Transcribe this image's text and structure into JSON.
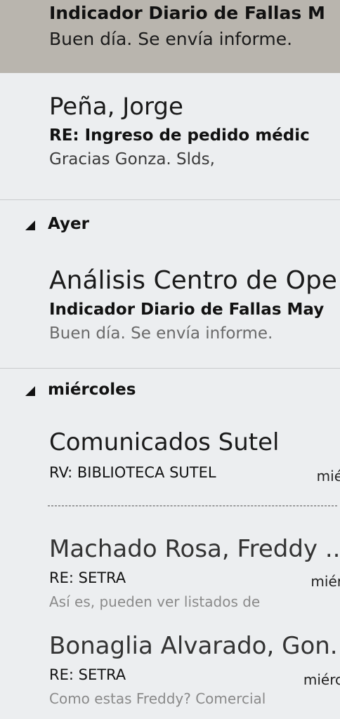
{
  "messages": [
    {
      "subject": "Indicador Diario de Fallas M",
      "preview": "Buen día.  Se envía informe."
    },
    {
      "sender": "Peña, Jorge",
      "subject": "RE: Ingreso de pedido médic",
      "preview": "Gracias Gonza.  Slds,"
    },
    {
      "sender": "Análisis Centro de Ope",
      "subject": "Indicador Diario de Fallas May",
      "preview": "Buen día.  Se envía informe."
    },
    {
      "sender": "Comunicados Sutel",
      "subject": "RV: BIBLIOTECA SUTEL",
      "date": "mié"
    },
    {
      "sender": "Machado Rosa, Freddy ...",
      "subject": "RE: SETRA",
      "date": "miér",
      "preview": "Así es, pueden ver listados de"
    },
    {
      "sender": "Bonaglia Alvarado, Gon...",
      "subject": "RE: SETRA",
      "date": "miérc",
      "preview": "Como estas Freddy?  Comercial"
    }
  ],
  "groups": {
    "ayer": "Ayer",
    "miercoles": "miércoles"
  }
}
